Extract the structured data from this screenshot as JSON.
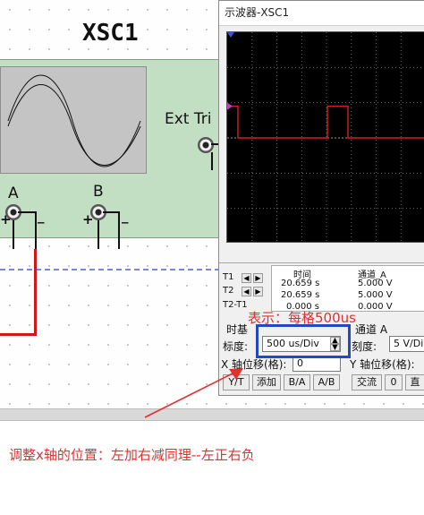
{
  "circuit": {
    "instrument_name": "XSC1",
    "ext_trigger_label": "Ext Tri",
    "channel_a_label": "A",
    "channel_b_label": "B",
    "plus": "+",
    "minus": "_"
  },
  "window": {
    "title": "示波器-XSC1"
  },
  "readout": {
    "t1_label": "T1",
    "t2_label": "T2",
    "t2t1_label": "T2-T1",
    "col_time": "时间",
    "col_channel_a": "通道_A",
    "rows": [
      {
        "time": "20.659 s",
        "ch_a": "5.000 V"
      },
      {
        "time": "20.659 s",
        "ch_a": "5.000 V"
      },
      {
        "time": "0.000 s",
        "ch_a": "0.000 V"
      }
    ]
  },
  "timebase": {
    "section_label": "时基",
    "scale_label": "标度:",
    "scale_value": "500 us/Div",
    "xpos_label": "X 轴位移(格):",
    "xpos_value": "0",
    "buttons": [
      "Y/T",
      "添加",
      "B/A",
      "A/B"
    ]
  },
  "channel_a": {
    "section_label": "通道 A",
    "scale_label": "刻度:",
    "scale_value": "5 V/Di",
    "ypos_label": "Y 轴位移(格):",
    "buttons": [
      "交流",
      "0",
      "直"
    ]
  },
  "annotations": {
    "top": "表示：每格500us",
    "bottom": "调整x轴的位置：左加右减同理--左正右负"
  },
  "colors": {
    "trace": "#d42020",
    "annotation_text": "#e03030",
    "annotation_box": "#2248c4",
    "scope_background": "#000000",
    "instrument_body": "#c3dfc3"
  }
}
